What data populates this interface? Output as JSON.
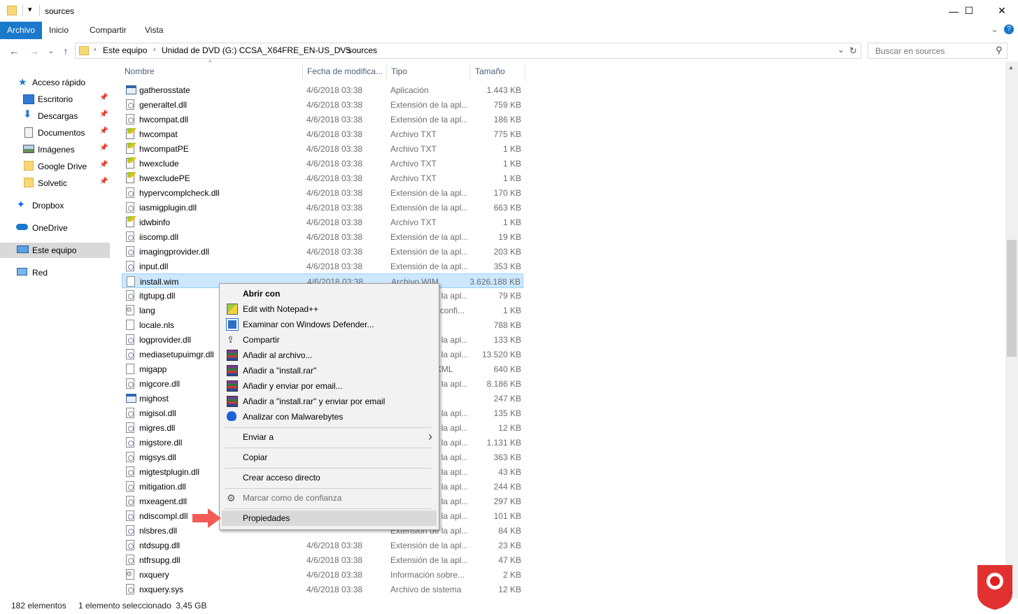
{
  "window": {
    "title": "sources",
    "quick_access_glyph": "▾",
    "minimize": "—",
    "maximize": "☐",
    "close": "✕"
  },
  "ribbon": {
    "tabs": [
      "Archivo",
      "Inicio",
      "Compartir",
      "Vista"
    ],
    "active_tab": "Archivo",
    "expand_glyph": "⌄",
    "help_glyph": "?"
  },
  "address": {
    "back": "←",
    "forward": "→",
    "recent": "⌄",
    "up": "↑",
    "crumbs": [
      "Este equipo",
      "Unidad de DVD (G:) CCSA_X64FRE_EN-US_DV5",
      "sources"
    ],
    "separator": "›",
    "dropdown": "⌄",
    "refresh": "↻",
    "search_placeholder": "Buscar en sources",
    "search_glyph": "⚲"
  },
  "nav": {
    "quick_access": "Acceso rápido",
    "pinned": [
      "Escritorio",
      "Descargas",
      "Documentos",
      "Imágenes",
      "Google Drive",
      "Solvetic"
    ],
    "pin_glyph": "📌",
    "dropbox": "Dropbox",
    "onedrive": "OneDrive",
    "this_pc": "Este equipo",
    "network": "Red"
  },
  "columns": {
    "name": "Nombre",
    "date": "Fecha de modifica...",
    "type": "Tipo",
    "size": "Tamaño",
    "sort_glyph": "^"
  },
  "files": [
    {
      "name": "gatherosstate",
      "date": "4/6/2018 03:38",
      "type": "Aplicación",
      "size": "1.443 KB",
      "icon": "app"
    },
    {
      "name": "generaltel.dll",
      "date": "4/6/2018 03:38",
      "type": "Extensión de la apl...",
      "size": "759 KB",
      "icon": "dll"
    },
    {
      "name": "hwcompat.dll",
      "date": "4/6/2018 03:38",
      "type": "Extensión de la apl...",
      "size": "186 KB",
      "icon": "dll"
    },
    {
      "name": "hwcompat",
      "date": "4/6/2018 03:38",
      "type": "Archivo TXT",
      "size": "775 KB",
      "icon": "txt"
    },
    {
      "name": "hwcompatPE",
      "date": "4/6/2018 03:38",
      "type": "Archivo TXT",
      "size": "1 KB",
      "icon": "txt"
    },
    {
      "name": "hwexclude",
      "date": "4/6/2018 03:38",
      "type": "Archivo TXT",
      "size": "1 KB",
      "icon": "txt"
    },
    {
      "name": "hwexcludePE",
      "date": "4/6/2018 03:38",
      "type": "Archivo TXT",
      "size": "1 KB",
      "icon": "txt"
    },
    {
      "name": "hypervcomplcheck.dll",
      "date": "4/6/2018 03:38",
      "type": "Extensión de la apl...",
      "size": "170 KB",
      "icon": "dll"
    },
    {
      "name": "iasmigplugin.dll",
      "date": "4/6/2018 03:38",
      "type": "Extensión de la apl...",
      "size": "663 KB",
      "icon": "dll"
    },
    {
      "name": "idwbinfo",
      "date": "4/6/2018 03:38",
      "type": "Archivo TXT",
      "size": "1 KB",
      "icon": "txt"
    },
    {
      "name": "iiscomp.dll",
      "date": "4/6/2018 03:38",
      "type": "Extensión de la apl...",
      "size": "19 KB",
      "icon": "dll"
    },
    {
      "name": "imagingprovider.dll",
      "date": "4/6/2018 03:38",
      "type": "Extensión de la apl...",
      "size": "203 KB",
      "icon": "dll"
    },
    {
      "name": "input.dll",
      "date": "4/6/2018 03:38",
      "type": "Extensión de la apl...",
      "size": "353 KB",
      "icon": "dll"
    },
    {
      "name": "install.wim",
      "date": "4/6/2018 03:38",
      "type": "Archivo WIM",
      "size": "3.626.188 KB",
      "icon": "blank",
      "selected": true
    },
    {
      "name": "itgtupg.dll",
      "date": "",
      "type": "Extensión de la apl...",
      "size": "79 KB",
      "icon": "dll"
    },
    {
      "name": "lang",
      "date": "",
      "type": "Opciones de confi...",
      "size": "1 KB",
      "icon": "cfg"
    },
    {
      "name": "locale.nls",
      "date": "",
      "type": "",
      "size": "788 KB",
      "icon": "blank"
    },
    {
      "name": "logprovider.dll",
      "date": "",
      "type": "Extensión de la apl...",
      "size": "133 KB",
      "icon": "dll"
    },
    {
      "name": "mediasetupuimgr.dll",
      "date": "",
      "type": "Extensión de la apl...",
      "size": "13.520 KB",
      "icon": "dll"
    },
    {
      "name": "migapp",
      "date": "",
      "type": "Documento XML",
      "size": "640 KB",
      "icon": "blank"
    },
    {
      "name": "migcore.dll",
      "date": "",
      "type": "Extensión de la apl...",
      "size": "8.186 KB",
      "icon": "dll"
    },
    {
      "name": "mighost",
      "date": "",
      "type": "",
      "size": "247 KB",
      "icon": "app"
    },
    {
      "name": "migisol.dll",
      "date": "",
      "type": "Extensión de la apl...",
      "size": "135 KB",
      "icon": "dll"
    },
    {
      "name": "migres.dll",
      "date": "",
      "type": "Extensión de la apl...",
      "size": "12 KB",
      "icon": "dll"
    },
    {
      "name": "migstore.dll",
      "date": "",
      "type": "Extensión de la apl...",
      "size": "1.131 KB",
      "icon": "dll"
    },
    {
      "name": "migsys.dll",
      "date": "",
      "type": "Extensión de la apl...",
      "size": "363 KB",
      "icon": "dll"
    },
    {
      "name": "migtestplugin.dll",
      "date": "",
      "type": "Extensión de la apl...",
      "size": "43 KB",
      "icon": "dll"
    },
    {
      "name": "mitigation.dll",
      "date": "",
      "type": "Extensión de la apl...",
      "size": "244 KB",
      "icon": "dll"
    },
    {
      "name": "mxeagent.dll",
      "date": "",
      "type": "Extensión de la apl...",
      "size": "297 KB",
      "icon": "dll"
    },
    {
      "name": "ndiscompl.dll",
      "date": "",
      "type": "Extensión de la apl...",
      "size": "101 KB",
      "icon": "dll"
    },
    {
      "name": "nlsbres.dll",
      "date": "",
      "type": "Extensión de la apl...",
      "size": "84 KB",
      "icon": "dll"
    },
    {
      "name": "ntdsupg.dll",
      "date": "4/6/2018 03:38",
      "type": "Extensión de la apl...",
      "size": "23 KB",
      "icon": "dll"
    },
    {
      "name": "ntfrsupg.dll",
      "date": "4/6/2018 03:38",
      "type": "Extensión de la apl...",
      "size": "47 KB",
      "icon": "dll"
    },
    {
      "name": "nxquery",
      "date": "4/6/2018 03:38",
      "type": "Información sobre...",
      "size": "2 KB",
      "icon": "cfg"
    },
    {
      "name": "nxquery.sys",
      "date": "4/6/2018 03:38",
      "type": "Archivo de sistema",
      "size": "12 KB",
      "icon": "dll"
    }
  ],
  "context_menu": {
    "items": [
      {
        "label": "Abrir con",
        "icon": "none",
        "bold": true
      },
      {
        "label": "Edit with Notepad++",
        "icon": "notepad-icon"
      },
      {
        "label": "Examinar con Windows Defender...",
        "icon": "defender-icon"
      },
      {
        "label": "Compartir",
        "icon": "share-icon"
      },
      {
        "label": "Añadir al archivo...",
        "icon": "winrar-icon"
      },
      {
        "label": "Añadir a \"install.rar\"",
        "icon": "winrar-icon"
      },
      {
        "label": "Añadir y enviar por email...",
        "icon": "winrar-icon"
      },
      {
        "label": "Añadir a \"install.rar\" y enviar por email",
        "icon": "winrar-icon"
      },
      {
        "label": "Analizar con Malwarebytes",
        "icon": "malwarebytes-icon"
      },
      {
        "label": "Enviar a",
        "icon": "none",
        "submenu": true
      },
      {
        "label": "Copiar",
        "icon": "none"
      },
      {
        "label": "Crear acceso directo",
        "icon": "none"
      },
      {
        "label": "Marcar como de confianza",
        "icon": "trust-icon",
        "disabled": true
      },
      {
        "label": "Propiedades",
        "icon": "none",
        "highlighted": true
      }
    ],
    "submenu_glyph": "›"
  },
  "status": {
    "count": "182 elementos",
    "selection": "1 elemento seleccionado  3,45 GB"
  },
  "colors": {
    "accent": "#1979ca",
    "selection": "#cce8ff",
    "arrow": "#f25c54"
  }
}
